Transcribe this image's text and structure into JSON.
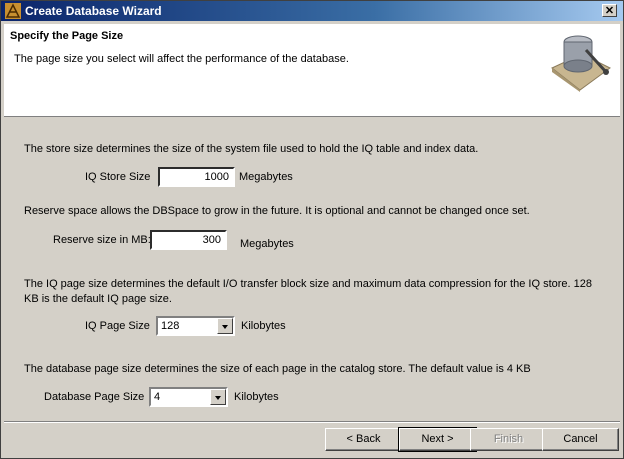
{
  "window": {
    "title": "Create Database Wizard"
  },
  "header": {
    "title": "Specify the Page Size",
    "description": "The page size you select will affect the performance of the database."
  },
  "store": {
    "description": "The store size determines the size of the system file used to hold the IQ table and index data.",
    "label": "IQ Store Size",
    "value": "1000",
    "unit": "Megabytes"
  },
  "reserve": {
    "description": "Reserve space allows the DBSpace to grow in the future.  It is optional and cannot be changed once set.",
    "label": "Reserve size in MB:",
    "value": "300",
    "unit": "Megabytes"
  },
  "iq_page": {
    "description": "The IQ page size determines the default I/O transfer block size and maximum data compression for the IQ store.  128 KB is the default IQ page size.",
    "label": "IQ Page Size",
    "value": "128",
    "unit": "Kilobytes"
  },
  "db_page": {
    "description": "The database page size determines the size of each page in the catalog store.  The default value is 4 KB",
    "label": "Database Page Size",
    "value": "4",
    "unit": "Kilobytes"
  },
  "buttons": {
    "back": "< Back",
    "next": "Next >",
    "finish": "Finish",
    "cancel": "Cancel"
  }
}
